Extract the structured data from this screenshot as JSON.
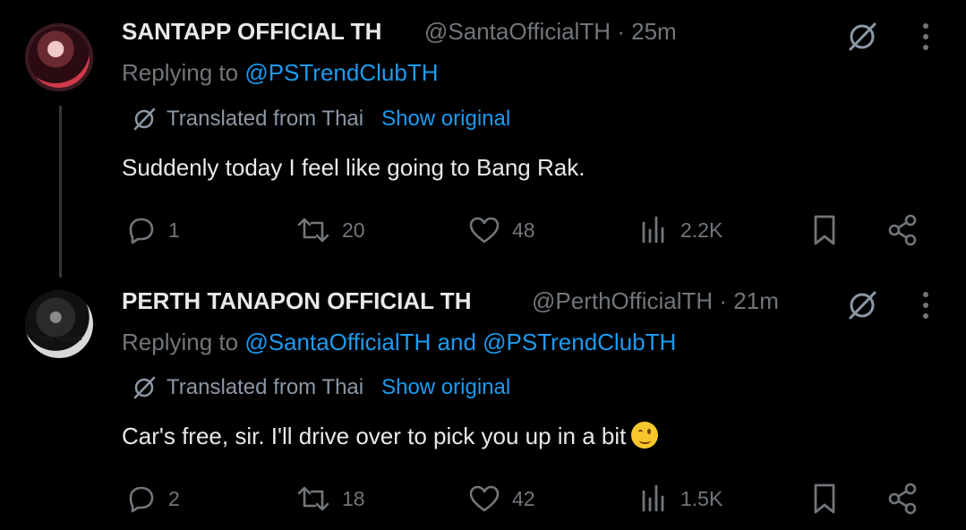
{
  "tweets": [
    {
      "name": "SANTAPP OFFICIAL TH",
      "handle": "@SantaOfficialTH",
      "time": "25m",
      "replying_prefix": "Replying to ",
      "replying_to": "@PSTrendClubTH",
      "translated_label": "Translated from Thai",
      "show_original": "Show original",
      "text": "Suddenly today I feel like going to Bang Rak.",
      "replies": "1",
      "reposts": "20",
      "likes": "48",
      "views": "2.2K"
    },
    {
      "name": "PERTH TANAPON OFFICIAL TH",
      "handle": "@PerthOfficialTH",
      "time": "21m",
      "replying_prefix": "Replying to ",
      "replying_to": "@SantaOfficialTH and @PSTrendClubTH",
      "translated_label": "Translated from Thai",
      "show_original": "Show original",
      "text": "Car's free, sir. I'll drive over to pick you up in a bit",
      "avatar_caption": "Perth Tanapon",
      "replies": "2",
      "reposts": "18",
      "likes": "42",
      "views": "1.5K"
    }
  ],
  "separator": " · ",
  "icons": [
    "grok-icon",
    "more-icon",
    "reply-icon",
    "repost-icon",
    "like-icon",
    "views-icon",
    "bookmark-icon",
    "share-icon",
    "translate-icon",
    "wink-emoji"
  ],
  "colors": {
    "background": "#000000",
    "text": "#e7e9ea",
    "muted": "#71767b",
    "link": "#1d9bf0"
  }
}
